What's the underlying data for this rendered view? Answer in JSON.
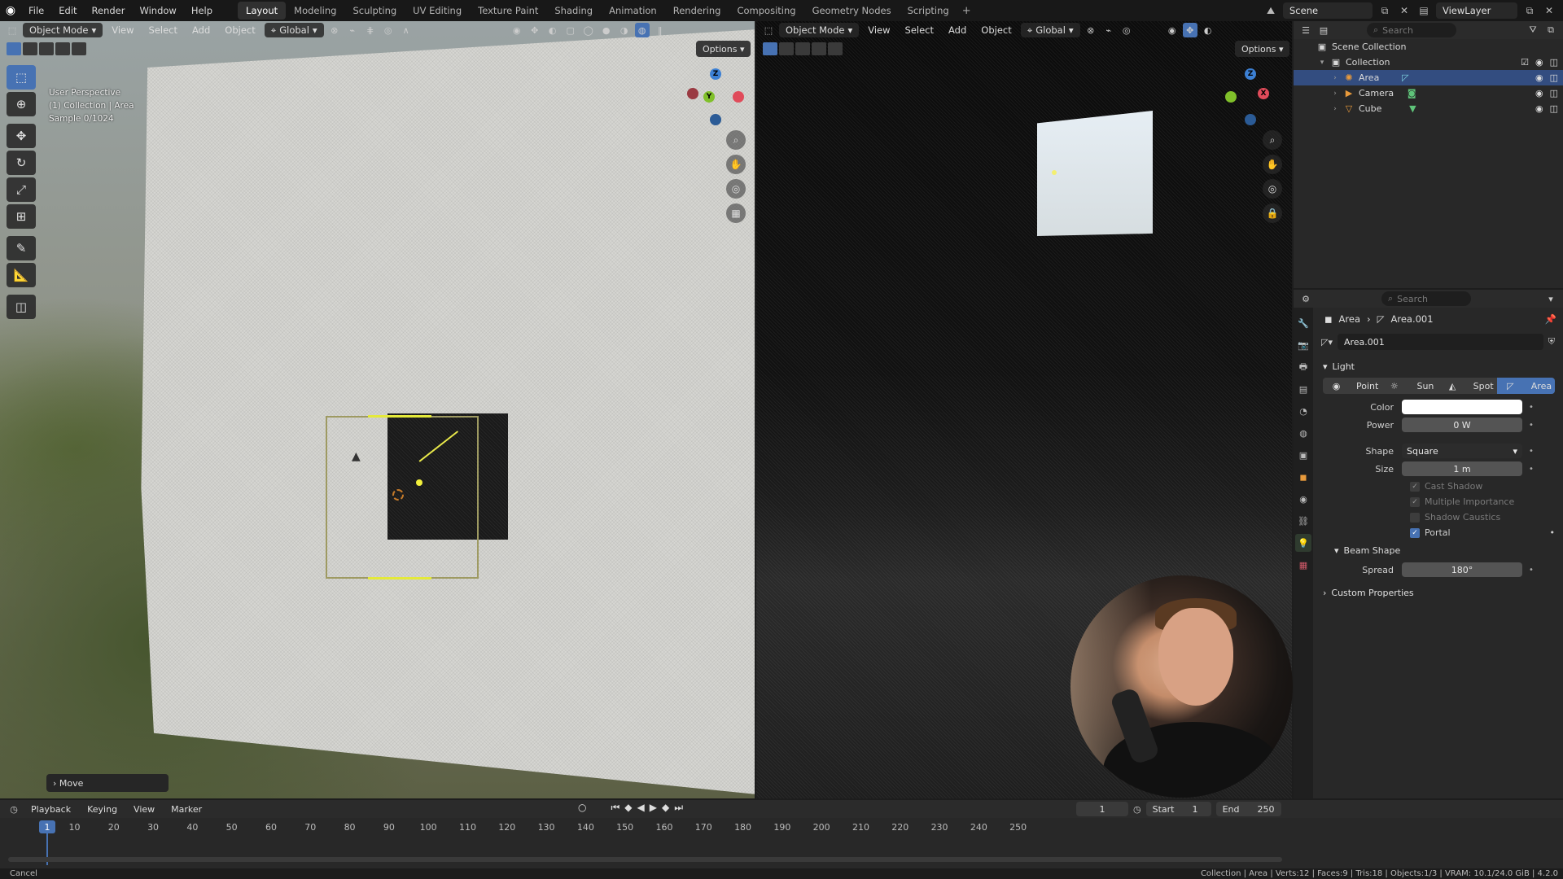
{
  "menu": [
    "File",
    "Edit",
    "Render",
    "Window",
    "Help"
  ],
  "workspaces": [
    "Layout",
    "Modeling",
    "Sculpting",
    "UV Editing",
    "Texture Paint",
    "Shading",
    "Animation",
    "Rendering",
    "Compositing",
    "Geometry Nodes",
    "Scripting"
  ],
  "active_workspace": "Layout",
  "scene": "Scene",
  "view_layer": "ViewLayer",
  "viewport_left": {
    "mode": "Object Mode",
    "menus": [
      "View",
      "Select",
      "Add",
      "Object"
    ],
    "transform_orientation": "Global",
    "options_label": "Options",
    "overlay_lines": [
      "User Perspective",
      "(1) Collection | Area",
      "Sample 0/1024"
    ],
    "last_operator": "Move"
  },
  "viewport_right": {
    "mode": "Object Mode",
    "menus": [
      "View",
      "Select",
      "Add",
      "Object"
    ],
    "transform_orientation": "Global",
    "options_label": "Options"
  },
  "gizmo_labels": {
    "x": "X",
    "y": "Y",
    "z": "Z"
  },
  "outliner": {
    "search_placeholder": "Search",
    "scene_collection": "Scene Collection",
    "collection": "Collection",
    "items": [
      {
        "name": "Area",
        "selected": true
      },
      {
        "name": "Camera",
        "selected": false
      },
      {
        "name": "Cube",
        "selected": false
      }
    ]
  },
  "properties": {
    "search_placeholder": "Search",
    "breadcrumb": [
      "Area",
      "Area.001"
    ],
    "datablock": "Area.001",
    "section_light": "Light",
    "light_types": [
      "Point",
      "Sun",
      "Spot",
      "Area"
    ],
    "active_light_type": "Area",
    "color_label": "Color",
    "color_value": "#ffffff",
    "power_label": "Power",
    "power_value": "0 W",
    "shape_label": "Shape",
    "shape_value": "Square",
    "size_label": "Size",
    "size_value": "1 m",
    "checkboxes": [
      {
        "label": "Cast Shadow",
        "checked": true,
        "enabled": false
      },
      {
        "label": "Multiple Importance",
        "checked": true,
        "enabled": false
      },
      {
        "label": "Shadow Caustics",
        "checked": false,
        "enabled": false
      },
      {
        "label": "Portal",
        "checked": true,
        "enabled": true
      }
    ],
    "beam_shape_label": "Beam Shape",
    "spread_label": "Spread",
    "spread_value": "180°",
    "custom_properties_label": "Custom Properties"
  },
  "timeline": {
    "menus": [
      "Playback",
      "Keying",
      "View",
      "Marker"
    ],
    "current_frame": "1",
    "start_label": "Start",
    "start_value": "1",
    "end_label": "End",
    "end_value": "250",
    "ticks": [
      "10",
      "20",
      "30",
      "40",
      "50",
      "60",
      "70",
      "80",
      "90",
      "100",
      "110",
      "120",
      "130",
      "140",
      "150",
      "160",
      "170",
      "180",
      "190",
      "200",
      "210",
      "220",
      "230",
      "240",
      "250"
    ],
    "playhead_label": "1"
  },
  "status": {
    "left": "Cancel",
    "right": "Collection | Area | Verts:12 | Faces:9 | Tris:18 | Objects:1/3 | VRAM: 10.1/24.0 GiB | 4.2.0"
  }
}
